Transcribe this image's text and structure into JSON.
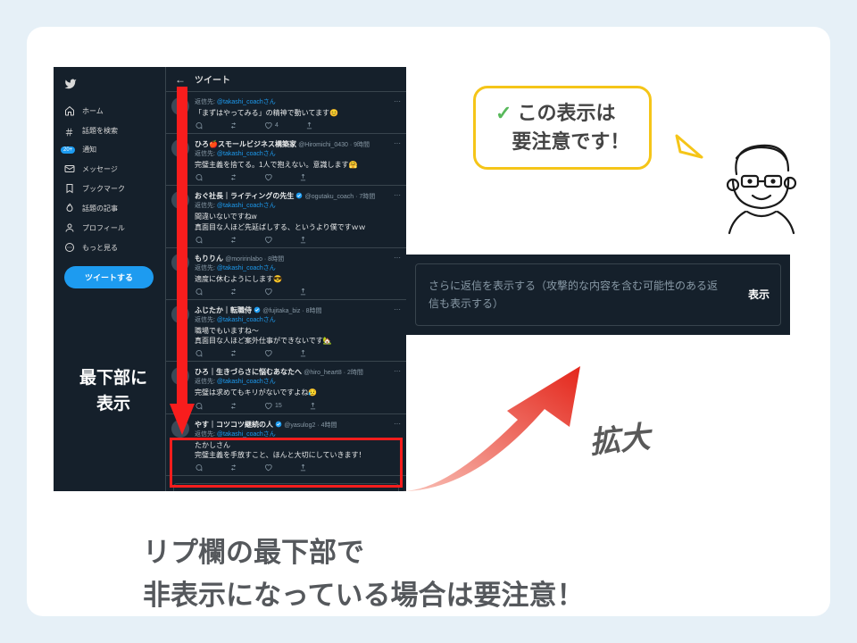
{
  "twitter": {
    "header": "ツイート",
    "nav": {
      "home": "ホーム",
      "explore": "話題を検索",
      "notifications": "通知",
      "notif_badge": "20+",
      "messages": "メッセージ",
      "bookmarks": "ブックマーク",
      "topics": "話題の記事",
      "profile": "プロフィール",
      "more": "もっと見る"
    },
    "tweet_button": "ツイートする",
    "reply_to_prefix": "返信先:",
    "reply_to_handle": "@takashi_coachさん",
    "feed": [
      {
        "name": "",
        "handle": "",
        "verified": false,
        "body": "「まずはやってみる」の精神で動いてます😊",
        "likes": "4"
      },
      {
        "name": "ひろ🍎スモールビジネス構築家",
        "handle": "@Hiromichi_0430 · 9時間",
        "verified": false,
        "body": "完璧主義を捨てる。1人で抱えない。意識します🤗",
        "likes": ""
      },
      {
        "name": "おぐ社長｜ライティングの先生",
        "handle": "@ogutaku_coach · 7時間",
        "verified": true,
        "body": "間違いないですねw\n真面目な人ほど先延ばしする、というより僕ですｗｗ",
        "likes": ""
      },
      {
        "name": "もりりん",
        "handle": "@moririnlabo · 8時間",
        "verified": false,
        "body": "適度に休むようにします😎",
        "likes": ""
      },
      {
        "name": "ふじたか｜転職侍",
        "handle": "@fujitaka_biz · 8時間",
        "verified": true,
        "body": "職場でもいますね〜\n真面目な人ほど案外仕事ができないです🏡",
        "likes": ""
      },
      {
        "name": "ひろ｜生きづらさに悩むあなたへ",
        "handle": "@hiro_heart8 · 2時間",
        "verified": false,
        "body": "完璧は求めてもキリがないですよね😥",
        "likes": "15"
      },
      {
        "name": "やす｜コツコツ継続の人",
        "handle": "@yasulog2 · 4時間",
        "verified": true,
        "body": "たかしさん\n完璧主義を手放すこと、ほんと大切にしていきます！",
        "likes": ""
      }
    ],
    "hidden_replies_text": "さらに返信を表示する（攻撃的な内容を含む可能性のある返信も表示する）",
    "show_button": "表示"
  },
  "callout": {
    "line1": "この表示は",
    "line2": "要注意です！"
  },
  "zoom_label": "拡大",
  "sidebar_caption_l1": "最下部に",
  "sidebar_caption_l2": "表示",
  "big_caption_l1": "リプ欄の最下部で",
  "big_caption_l2": "非表示になっている場合は要注意！"
}
